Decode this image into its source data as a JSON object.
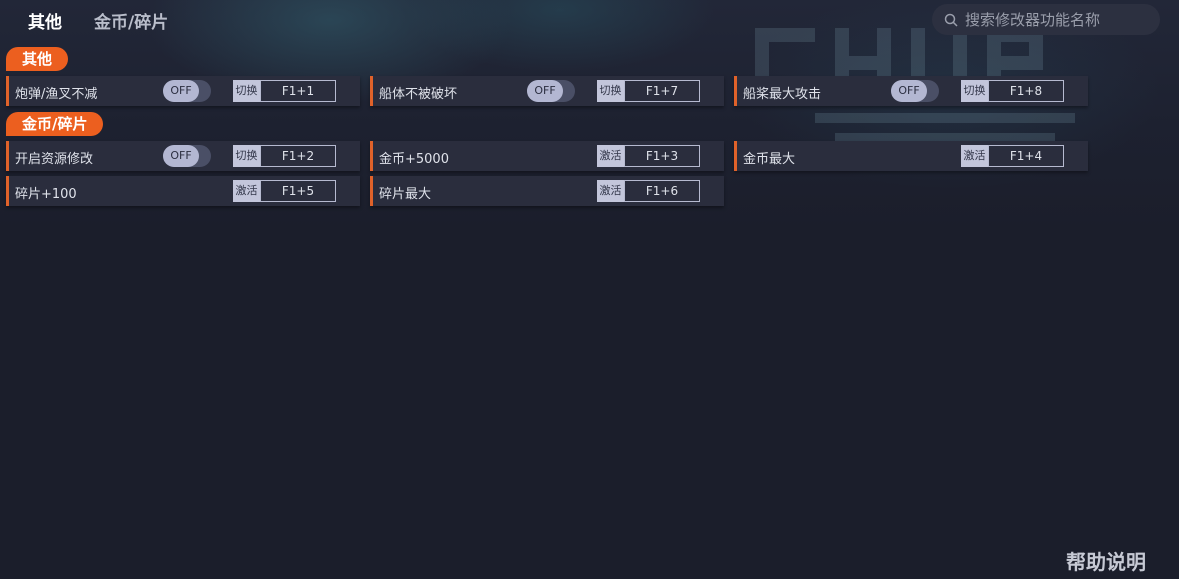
{
  "nav": {
    "tabs": [
      {
        "label": "其他",
        "active": true
      },
      {
        "label": "金币/碎片",
        "active": false
      }
    ]
  },
  "search": {
    "placeholder": "搜索修改器功能名称",
    "icon": "search-icon"
  },
  "sections": [
    {
      "title": "其他",
      "items": [
        {
          "label": "炮弹/渔叉不减",
          "toggle": "OFF",
          "action": "切换",
          "hotkey": "F1+1"
        },
        {
          "label": "船体不被破坏",
          "toggle": "OFF",
          "action": "切换",
          "hotkey": "F1+7"
        },
        {
          "label": "船桨最大攻击",
          "toggle": "OFF",
          "action": "切换",
          "hotkey": "F1+8"
        }
      ]
    },
    {
      "title": "金币/碎片",
      "items": [
        {
          "label": "开启资源修改",
          "toggle": "OFF",
          "action": "切换",
          "hotkey": "F1+2"
        },
        {
          "label": "金币+5000",
          "action": "激活",
          "hotkey": "F1+3"
        },
        {
          "label": "金币最大",
          "action": "激活",
          "hotkey": "F1+4"
        },
        {
          "label": "碎片+100",
          "action": "激活",
          "hotkey": "F1+5"
        },
        {
          "label": "碎片最大",
          "action": "激活",
          "hotkey": "F1+6"
        }
      ]
    }
  ],
  "footer": {
    "help_label": "帮助说明"
  },
  "colors": {
    "background": "#1b1e2b",
    "accent": "#ec5f1f",
    "row_background": "#2a2d3d",
    "toggle_knob": "#b3b7d2"
  }
}
